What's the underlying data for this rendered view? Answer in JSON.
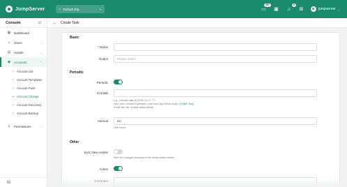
{
  "app": {
    "name": "JumpServer"
  },
  "topbar": {
    "org_label": "Default Org",
    "badge_tasks": "99+",
    "badge_messages": "6",
    "user_name": "jumpserver"
  },
  "sidebar": {
    "title": "Console",
    "items": [
      {
        "icon": "dashboard-icon",
        "label": "Dashboard"
      },
      {
        "icon": "users-icon",
        "label": "Users"
      },
      {
        "icon": "assets-icon",
        "label": "Assets"
      },
      {
        "icon": "accounts-icon",
        "label": "Accounts"
      }
    ],
    "subitems": [
      {
        "label": "Account List"
      },
      {
        "label": "Account Templates"
      },
      {
        "label": "Account Push"
      },
      {
        "label": "Account Change"
      },
      {
        "label": "Account Discovery"
      },
      {
        "label": "Account Backup"
      }
    ],
    "permissions_label": "Permissions"
  },
  "page": {
    "title": "Create Task",
    "sections": {
      "basic": "Basic",
      "periodic": "Periodic",
      "other": "Other"
    },
    "fields": {
      "name_label": "Name",
      "nodes_label": "Nodes",
      "nodes_placeholder": "Please select",
      "periodic_label": "Periodic",
      "crontab_label": "Crontab",
      "crontab_help_1": "e.g.: execute daily at 03:05 <5 3 * * *>",
      "crontab_help_2": "Use Linux crontab expression <min hour day month week>",
      "crontab_link": "(Online Tool)",
      "crontab_help_3": "If both are set, crontab takes priority",
      "interval_label": "Interval",
      "interval_value": "24",
      "interval_unit": "Unit: hours",
      "sync_label": "Sync New Assets",
      "sync_help": "Sync the changed accounts to the newly added assets",
      "active_label": "Active",
      "comment_label": "Comment"
    },
    "toggles": {
      "periodic": true,
      "sync_new_assets": false,
      "active": true
    }
  },
  "colors": {
    "brand": "#1a8a6c"
  }
}
